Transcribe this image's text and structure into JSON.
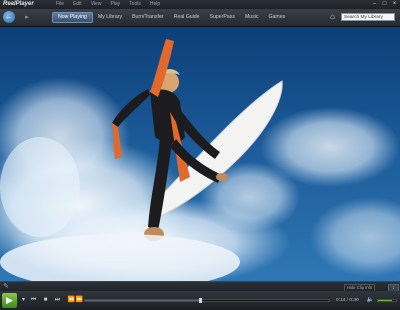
{
  "app": {
    "logo_text": "RealPlayer"
  },
  "menu": {
    "items": [
      "File",
      "Edit",
      "View",
      "Play",
      "Tools",
      "Help"
    ]
  },
  "nav": {
    "tabs": [
      "Now Playing",
      "My Library",
      "Burn/Transfer",
      "Real Guide",
      "SuperPass",
      "Music",
      "Games"
    ],
    "active_tab": "Now Playing"
  },
  "search": {
    "value": "Search My Library"
  },
  "status": {
    "hide_label": "Hide Clip Info",
    "expand_label": "↕"
  },
  "player": {
    "time": "0:14 / 0:30",
    "progress": 0.47,
    "volume": 0.8
  },
  "colors": {
    "accent_play": "#5fae32",
    "active_tab": "#4a6688"
  },
  "icons": {
    "back": "back-arrow-icon",
    "forward": "forward-icon",
    "home": "home-icon",
    "play": "play-icon",
    "volume": "volume-icon"
  }
}
